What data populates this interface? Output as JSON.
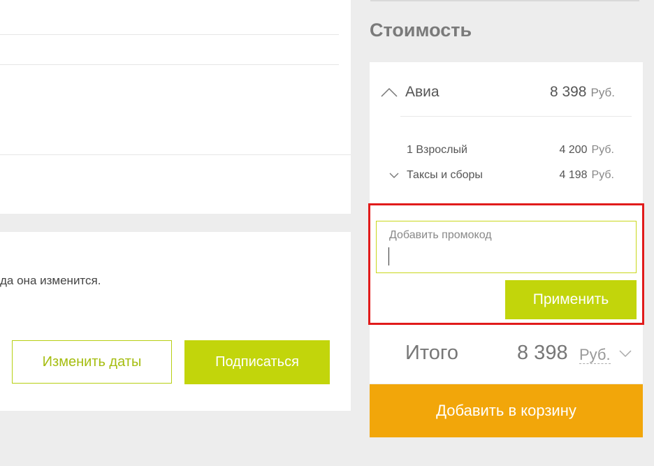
{
  "left": {
    "notice_text": "да она изменится.",
    "change_dates_button": "Изменить даты",
    "subscribe_button": "Подписаться"
  },
  "cost": {
    "title": "Стоимость",
    "avia": {
      "label": "Авиа",
      "price": "8 398",
      "currency": "Руб.",
      "icon": "chevron-up-icon"
    },
    "items": [
      {
        "label": "1 Взрослый",
        "price": "4 200",
        "currency": "Руб."
      },
      {
        "label": "Таксы и сборы",
        "price": "4 198",
        "currency": "Руб.",
        "icon": "chevron-down-icon"
      }
    ],
    "promo": {
      "placeholder": "Добавить промокод",
      "value": "",
      "apply_button": "Применить"
    },
    "total": {
      "label": "Итого",
      "price": "8 398",
      "currency": "Руб."
    },
    "cart_button": "Добавить в корзину"
  },
  "colors": {
    "accent_green": "#c2d50b",
    "cart_orange": "#f2a60a",
    "highlight_red": "#e11b1b"
  }
}
